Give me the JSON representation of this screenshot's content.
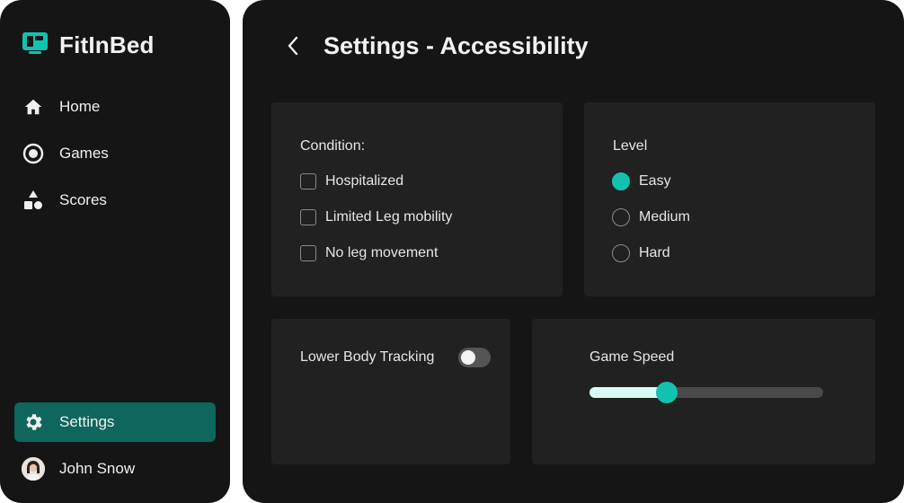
{
  "app": {
    "name": "FitInBed"
  },
  "sidebar": {
    "items": [
      {
        "label": "Home",
        "icon": "home-icon"
      },
      {
        "label": "Games",
        "icon": "target-icon"
      },
      {
        "label": "Scores",
        "icon": "shapes-icon"
      }
    ],
    "settings": {
      "label": "Settings",
      "icon": "gear-icon",
      "active": true
    },
    "user": {
      "name": "John Snow"
    }
  },
  "header": {
    "title": "Settings - Accessibility"
  },
  "condition": {
    "title": "Condition:",
    "options": [
      {
        "label": "Hospitalized",
        "checked": false
      },
      {
        "label": "Limited Leg mobility",
        "checked": false
      },
      {
        "label": "No leg movement",
        "checked": false
      }
    ]
  },
  "level": {
    "title": "Level",
    "options": [
      {
        "label": "Easy",
        "selected": true
      },
      {
        "label": "Medium",
        "selected": false
      },
      {
        "label": "Hard",
        "selected": false
      }
    ]
  },
  "tracking": {
    "label": "Lower Body Tracking",
    "enabled": false
  },
  "speed": {
    "label": "Game Speed",
    "value": 0.33
  },
  "colors": {
    "accent": "#12c2b0",
    "active_nav": "#0e665d",
    "panel": "#151515",
    "card": "#212121"
  }
}
